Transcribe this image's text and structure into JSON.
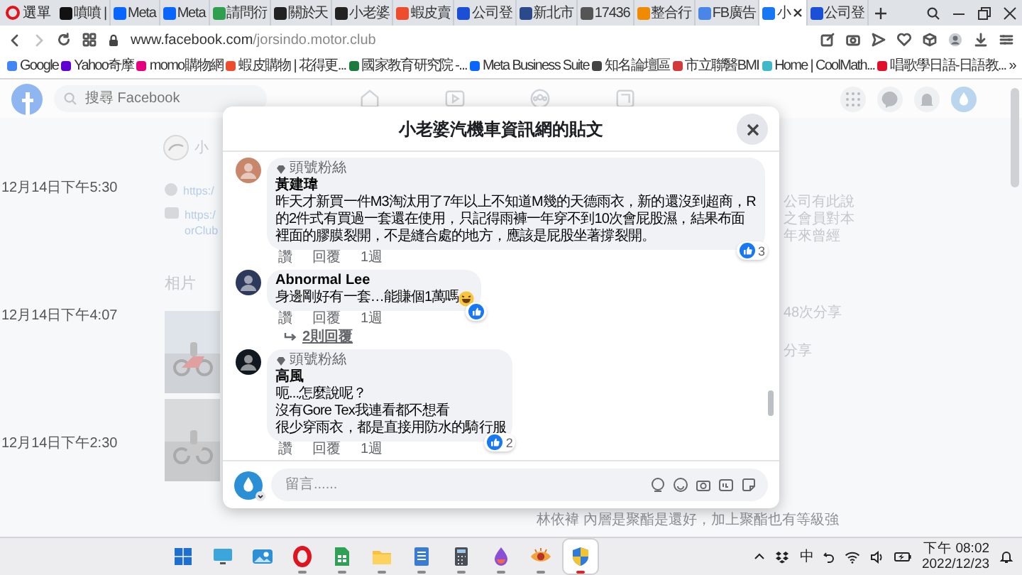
{
  "browser": {
    "menu": "選單",
    "tabs": [
      {
        "title": "噴噴 |",
        "color": "#111111",
        "selected": false
      },
      {
        "title": "Meta",
        "color": "#0866ff",
        "selected": false
      },
      {
        "title": "Meta",
        "color": "#0866ff",
        "selected": false
      },
      {
        "title": "請問衍",
        "color": "#2e9e4f",
        "selected": false
      },
      {
        "title": "關於天",
        "color": "#222222",
        "selected": false
      },
      {
        "title": "小老婆",
        "color": "#222222",
        "selected": false
      },
      {
        "title": "蝦皮賣",
        "color": "#ee4d2d",
        "selected": false
      },
      {
        "title": "公司登",
        "color": "#1a4fd6",
        "selected": false
      },
      {
        "title": "新北市",
        "color": "#2b4a8b",
        "selected": false
      },
      {
        "title": "17436",
        "color": "#555555",
        "selected": false
      },
      {
        "title": "整合行",
        "color": "#f08a00",
        "selected": false
      },
      {
        "title": "FB廣告",
        "color": "#4a86e8",
        "selected": false
      },
      {
        "title": "小",
        "color": "#1877f2",
        "selected": true
      },
      {
        "title": "公司登",
        "color": "#1a4fd6",
        "selected": false
      }
    ],
    "can_go_forward": false,
    "address": {
      "host": "www.facebook.com",
      "path": "/jorsindo.motor.club"
    },
    "bookmarks": [
      {
        "title": "Google",
        "color": "#4285f4"
      },
      {
        "title": "Yahoo奇摩",
        "color": "#6001d2"
      },
      {
        "title": "momo購物網",
        "color": "#e4007f"
      },
      {
        "title": "蝦皮購物 | 花得更...",
        "color": "#ee4d2d"
      },
      {
        "title": "國家教育研究院 -...",
        "color": "#1b7a3e"
      },
      {
        "title": "Meta Business Suite",
        "color": "#0866ff"
      },
      {
        "title": "知名論壇區",
        "color": "#444444"
      },
      {
        "title": "市立聯醫BMI",
        "color": "#d33b3b"
      },
      {
        "title": "Home | CoolMath...",
        "color": "#3fb8c9"
      },
      {
        "title": "唱歌學日語-日語教...",
        "color": "#e0102a"
      }
    ],
    "bookmarks_more": "»"
  },
  "facebook": {
    "search_placeholder": "搜尋 Facebook",
    "page_initial": "小",
    "links": [
      [
        "https:/"
      ],
      [
        "https:/",
        "orClub"
      ]
    ],
    "timestamps": [
      "12月14日下午5:30",
      "12月14日下午4:07",
      "12月14日下午2:30"
    ],
    "photos_heading": "相片",
    "side_texts": [
      "公司有此說",
      "之會員對本",
      "年來曾經"
    ],
    "share_count": "48次分享",
    "share_label": "分享",
    "feed_comment": {
      "author": "林依褘",
      "text": "內層是聚酯是還好，加上聚酯也有等級強"
    }
  },
  "post": {
    "title": "小老婆汽機車資訊網的貼文",
    "comments": [
      {
        "badge": "頭號粉絲",
        "author": "黃建瑋",
        "lines": [
          "昨天才新買一件M3淘汰用了7年以上不知道M幾的天德雨衣，新的還沒到超商，R的2件式有買過一套還在使用，只記得雨褲一年穿不到10次會屁股濕，結果布面裡面的膠膜裂開，不是縫合處的地方，應該是屁股坐著撐裂開。"
        ],
        "trailing_emoji": false,
        "reacted": true,
        "reaction_count": "3",
        "actions": [
          "讚",
          "回覆",
          "1週"
        ]
      },
      {
        "author": "Abnormal Lee",
        "lines": [
          "身邊剛好有一套…能賺個1萬嗎"
        ],
        "trailing_emoji": true,
        "reacted": true,
        "actions": [
          "讚",
          "回覆",
          "1週"
        ],
        "replies": "2則回覆"
      },
      {
        "badge": "頭號粉絲",
        "author": "高風",
        "lines": [
          "呃...怎麼說呢？",
          "沒有Gore Tex我連看都不想看",
          "很少穿雨衣，都是直接用防水的騎行服"
        ],
        "trailing_emoji": false,
        "reacted": true,
        "reaction_count": "2",
        "actions": [
          "讚",
          "回覆",
          "1週"
        ]
      }
    ],
    "composer": {
      "placeholder": "留言......"
    }
  },
  "taskbar": {
    "apps": [
      {
        "running": false,
        "active": false
      },
      {
        "running": false,
        "active": false
      },
      {
        "running": false,
        "active": false
      },
      {
        "running": true,
        "active": false
      },
      {
        "running": true,
        "active": false
      },
      {
        "running": true,
        "active": false
      },
      {
        "running": true,
        "active": false
      },
      {
        "running": true,
        "active": false
      },
      {
        "running": true,
        "active": false
      },
      {
        "running": true,
        "active": false
      },
      {
        "running": true,
        "active": true
      }
    ],
    "language": "中",
    "time": "下午 08:02",
    "date": "2022/12/23"
  }
}
